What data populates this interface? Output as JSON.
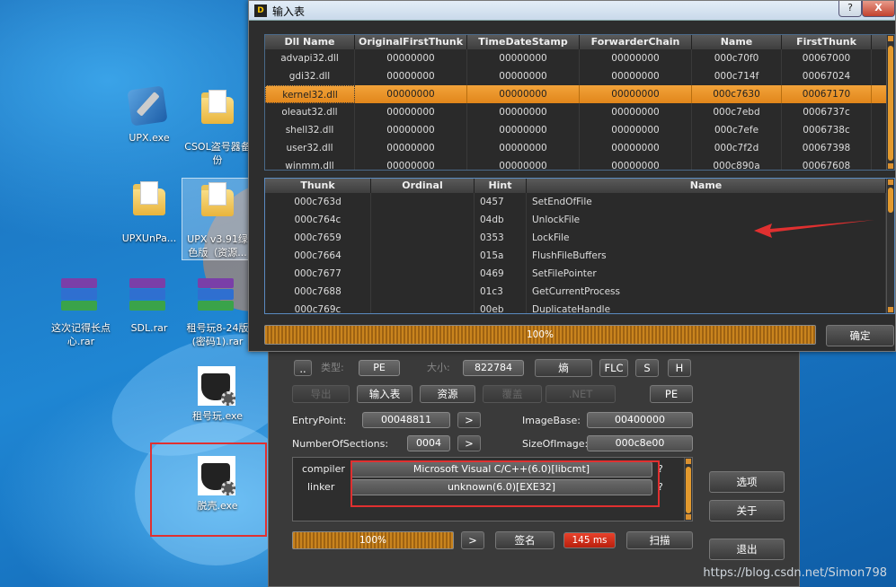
{
  "desktop": {
    "icons": [
      {
        "name": "upx-exe-icon",
        "label": "UPX.exe"
      },
      {
        "name": "csol-folder-icon",
        "label": "CSOL盗号器备份"
      },
      {
        "name": "upxunpa-folder-icon",
        "label": "UPXUnPa..."
      },
      {
        "name": "upx-folder-icon",
        "label": "UPX v3.91绿色版（资源..."
      },
      {
        "name": "rar-archive-icon",
        "label": "这次记得长点心.rar"
      },
      {
        "name": "rar-archive-icon",
        "label": "SDL.rar"
      },
      {
        "name": "rar-archive-icon",
        "label": "租号玩8-24版(密码1).rar"
      },
      {
        "name": "zuhaowan-exe-icon",
        "label": "租号玩.exe"
      },
      {
        "name": "tuoke-exe-icon",
        "label": "脱壳.exe"
      }
    ],
    "watermark": "https://blog.csdn.net/Simon798"
  },
  "import_window": {
    "title": "输入表",
    "help_btn": "?",
    "close_btn": "X",
    "dll_columns": [
      "Dll Name",
      "OriginalFirstThunk",
      "TimeDateStamp",
      "ForwarderChain",
      "Name",
      "FirstThunk"
    ],
    "dll_rows": [
      [
        "advapi32.dll",
        "00000000",
        "00000000",
        "00000000",
        "000c70f0",
        "00067000"
      ],
      [
        "gdi32.dll",
        "00000000",
        "00000000",
        "00000000",
        "000c714f",
        "00067024"
      ],
      [
        "kernel32.dll",
        "00000000",
        "00000000",
        "00000000",
        "000c7630",
        "00067170"
      ],
      [
        "oleaut32.dll",
        "00000000",
        "00000000",
        "00000000",
        "000c7ebd",
        "0006737c"
      ],
      [
        "shell32.dll",
        "00000000",
        "00000000",
        "00000000",
        "000c7efe",
        "0006738c"
      ],
      [
        "user32.dll",
        "00000000",
        "00000000",
        "00000000",
        "000c7f2d",
        "00067398"
      ],
      [
        "winmm.dll",
        "00000000",
        "00000000",
        "00000000",
        "000c890a",
        "00067608"
      ]
    ],
    "selected_dll": "kernel32.dll",
    "func_columns": [
      "Thunk",
      "Ordinal",
      "Hint",
      "Name"
    ],
    "func_rows": [
      [
        "000c763d",
        "",
        "0457",
        "SetEndOfFile"
      ],
      [
        "000c764c",
        "",
        "04db",
        "UnlockFile"
      ],
      [
        "000c7659",
        "",
        "0353",
        "LockFile"
      ],
      [
        "000c7664",
        "",
        "015a",
        "FlushFileBuffers"
      ],
      [
        "000c7677",
        "",
        "0469",
        "SetFilePointer"
      ],
      [
        "000c7688",
        "",
        "01c3",
        "GetCurrentProcess"
      ],
      [
        "000c769c",
        "",
        "00eb",
        "DuplicateHandle"
      ]
    ],
    "progress": "100%",
    "progress_value": 1.0,
    "ok_btn": "确定"
  },
  "main_window": {
    "menu_btn": "..",
    "type_label": "类型:",
    "type_value": "PE",
    "size_label": "大小:",
    "size_value": "822784",
    "entropy_btn": "熵",
    "flc_btn": "FLC",
    "s_btn": "S",
    "h_btn": "H",
    "export_btn": "导出",
    "import_btn": "输入表",
    "resource_btn": "资源",
    "overlay_btn": "覆盖",
    "net_btn": ".NET",
    "pe_btn": "PE",
    "entrypoint_label": "EntryPoint:",
    "entrypoint_value": "00048811",
    "imagebase_label": "ImageBase:",
    "imagebase_value": "00400000",
    "sections_label": "NumberOfSections:",
    "sections_value": "0004",
    "sizeofimage_label": "SizeOfImage:",
    "sizeofimage_value": "000c8e00",
    "arrow_btn": ">",
    "compiler_label": "compiler",
    "compiler_value": "Microsoft Visual C/C++(6.0)[libcmt]",
    "linker_label": "linker",
    "linker_value": "unknown(6.0)[EXE32]",
    "q_mark": "?",
    "progress": "100%",
    "progress_value": 1.0,
    "sign_btn": "签名",
    "time_value": "145 ms",
    "scan_btn": "扫描",
    "options_btn": "选项",
    "about_btn": "关于",
    "exit_btn": "退出"
  },
  "colors": {
    "accent": "#e1861b",
    "annotation": "#e03030"
  }
}
